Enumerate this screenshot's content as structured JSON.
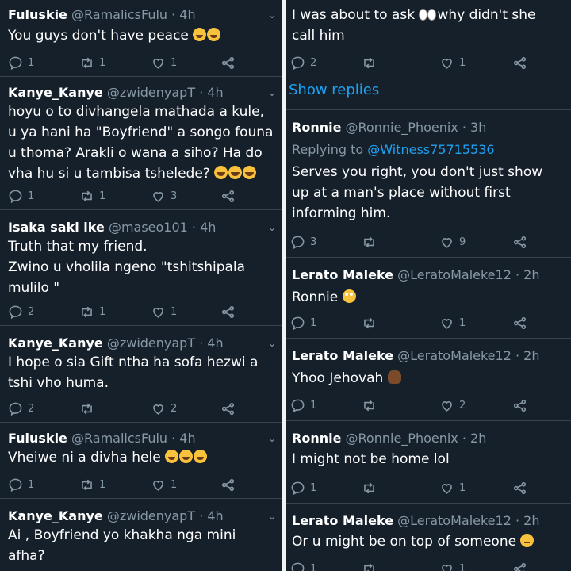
{
  "left": {
    "tweets": [
      {
        "name": "Fuluskie",
        "handle": "@RamalicsFulu · 4h",
        "text": "You guys don't have peace",
        "emoji": "laugh",
        "emoji_count": 2,
        "replies": "1",
        "retweets": "1",
        "likes": "1"
      },
      {
        "name": "Kanye_Kanye",
        "handle": "@zwidenyapT · 4h",
        "text": "hoyu o to divhangela mathada a kule, u ya hani ha \"Boyfriend\" a songo founa u thoma? Arakli o wana a siho? Ha do vha hu si u tambisa tshelede?",
        "emoji": "joy",
        "emoji_count": 3,
        "replies": "1",
        "retweets": "1",
        "likes": "3"
      },
      {
        "name": "Isaka saki ike",
        "handle": "@maseo101 · 4h",
        "text": "Truth that my friend.\nZwino u vholila ngeno \"tshitshipala mulilo \"",
        "emoji": "",
        "emoji_count": 0,
        "replies": "2",
        "retweets": "1",
        "likes": "1"
      },
      {
        "name": "Kanye_Kanye",
        "handle": "@zwidenyapT · 4h",
        "text": "I hope o sia Gift ntha ha sofa hezwi a tshi vho huma.",
        "emoji": "",
        "emoji_count": 0,
        "replies": "2",
        "retweets": "",
        "likes": "2"
      },
      {
        "name": "Fuluskie",
        "handle": "@RamalicsFulu · 4h",
        "text": "Vheiwe ni a divha hele",
        "emoji": "laugh",
        "emoji_count": 3,
        "replies": "1",
        "retweets": "1",
        "likes": "1"
      },
      {
        "name": "Kanye_Kanye",
        "handle": "@zwidenyapT · 4h",
        "text": "Ai , Boyfriend yo khakha nga mini afha?",
        "emoji": "",
        "emoji_count": 0,
        "replies": "",
        "retweets": "",
        "likes": ""
      }
    ]
  },
  "right": {
    "top_fragment": {
      "text": "I was about to ask",
      "text2": "why didn't she call him",
      "replies": "2",
      "retweets": "",
      "likes": "1"
    },
    "show_replies": "Show replies",
    "tweets": [
      {
        "name": "Ronnie",
        "handle": "@Ronnie_Phoenix · 3h",
        "replying_prefix": "Replying to ",
        "replying_to": "@Witness75715536",
        "text": "Serves you right, you don't just show up at a man's place without first informing him.",
        "emoji": "",
        "replies": "3",
        "retweets": "",
        "likes": "9"
      },
      {
        "name": "Lerato Maleke",
        "handle": "@LeratoMaleke12 · 2h",
        "text": "Ronnie",
        "emoji": "flush",
        "replies": "1",
        "retweets": "",
        "likes": "1"
      },
      {
        "name": "Lerato Maleke",
        "handle": "@LeratoMaleke12 · 2h",
        "text": "Yhoo Jehovah",
        "emoji": "facepalm",
        "replies": "1",
        "retweets": "",
        "likes": "2"
      },
      {
        "name": "Ronnie",
        "handle": "@Ronnie_Phoenix · 2h",
        "text": "I might not be home lol",
        "emoji": "",
        "replies": "1",
        "retweets": "",
        "likes": "1"
      },
      {
        "name": "Lerato Maleke",
        "handle": "@LeratoMaleke12 · 2h",
        "text": "Or u might be on top of someone",
        "emoji": "sad",
        "replies": "1",
        "retweets": "",
        "likes": "1"
      }
    ]
  },
  "icons": {
    "reply": "reply-icon",
    "retweet": "retweet-icon",
    "like": "heart-icon",
    "share": "share-icon",
    "caret": "chevron-down-icon"
  },
  "colors": {
    "background": "#15202b",
    "secondary_text": "#8899a6",
    "link": "#1da1f2",
    "divider": "#38444d"
  }
}
